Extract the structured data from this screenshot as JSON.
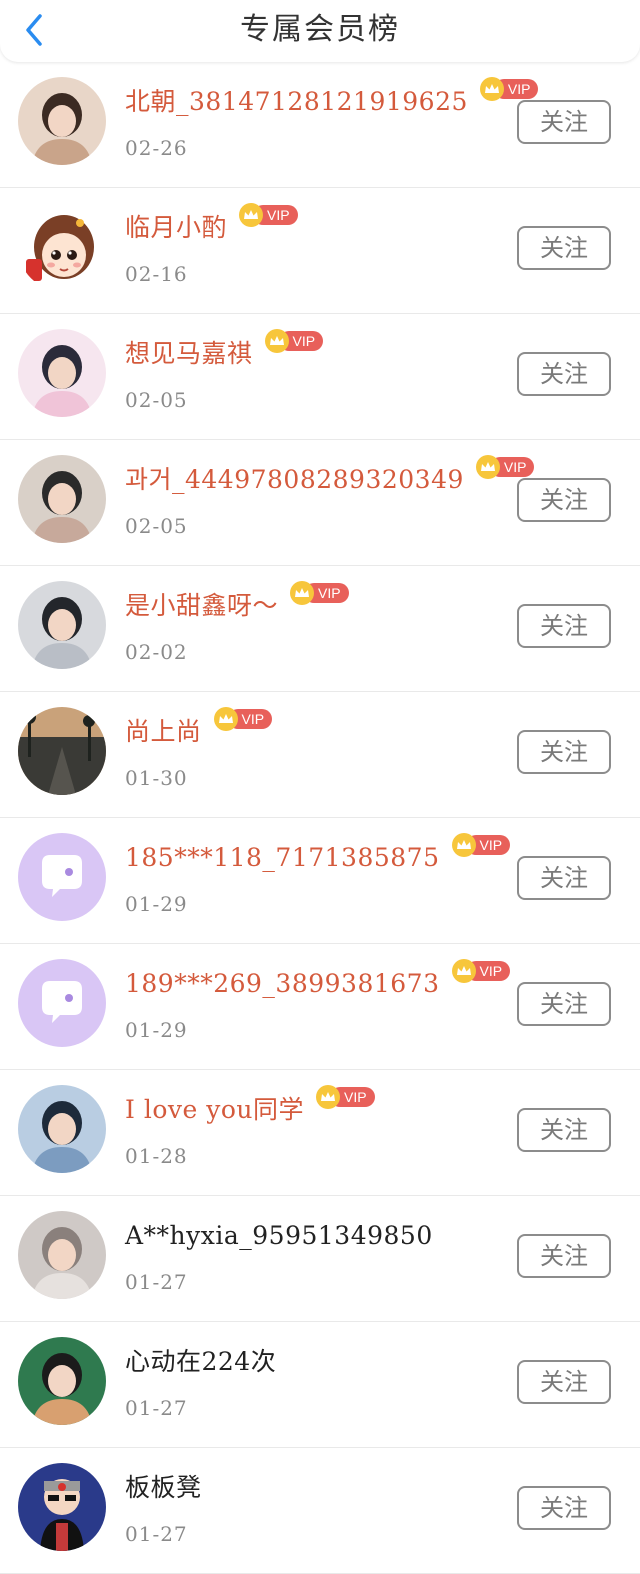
{
  "header": {
    "title": "专属会员榜"
  },
  "colors": {
    "vip_name": "#d45a3c",
    "normal_name": "#222222",
    "vip_badge": "#e8605a",
    "crown": "#f7c63b",
    "back_arrow": "#2a8cf0"
  },
  "vip_badge_label": "VIP",
  "members": [
    {
      "name": "北朝_3814712812191962​5",
      "date": "02-26",
      "vip": true,
      "follow_label": "关注",
      "avatar": "photo-avatar"
    },
    {
      "name": "临月小酌",
      "date": "02-16",
      "vip": true,
      "follow_label": "关注",
      "avatar": "cartoon-girl-avatar"
    },
    {
      "name": "想见马嘉祺",
      "date": "02-05",
      "vip": true,
      "follow_label": "关注",
      "avatar": "photo-avatar"
    },
    {
      "name": "과거_44497808289320349",
      "date": "02-05",
      "vip": true,
      "follow_label": "关注",
      "avatar": "photo-avatar"
    },
    {
      "name": "是小甜鑫呀～",
      "date": "02-02",
      "vip": true,
      "follow_label": "关注",
      "avatar": "photo-avatar"
    },
    {
      "name": "尚上尚",
      "date": "01-30",
      "vip": true,
      "follow_label": "关注",
      "avatar": "landscape-avatar"
    },
    {
      "name": "185***118_7171385875",
      "date": "01-29",
      "vip": true,
      "follow_label": "关注",
      "avatar": "default-chat-avatar"
    },
    {
      "name": "189***269_3899381673",
      "date": "01-29",
      "vip": true,
      "follow_label": "关注",
      "avatar": "default-chat-avatar"
    },
    {
      "name": "I love you同学",
      "date": "01-28",
      "vip": true,
      "follow_label": "关注",
      "avatar": "photo-avatar"
    },
    {
      "name": "A**hyxia_95951349850",
      "date": "01-27",
      "vip": false,
      "follow_label": "关注",
      "avatar": "photo-avatar"
    },
    {
      "name": "心动在224次",
      "date": "01-27",
      "vip": false,
      "follow_label": "关注",
      "avatar": "photo-avatar"
    },
    {
      "name": "板板凳",
      "date": "01-27",
      "vip": false,
      "follow_label": "关注",
      "avatar": "cartoon-avatar"
    }
  ]
}
